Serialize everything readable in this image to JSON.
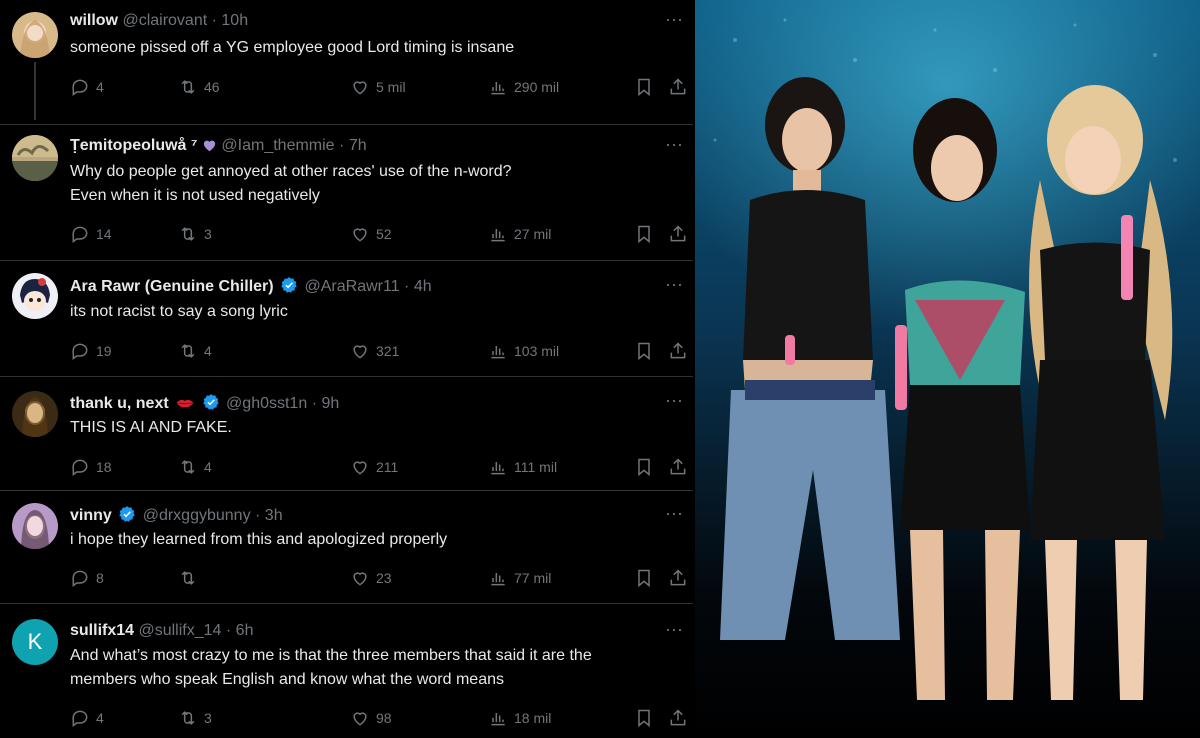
{
  "tweets": [
    {
      "name": "willow",
      "handle": "@clairovant",
      "time": "10h",
      "text": "someone pissed off a YG employee good Lord timing is insane",
      "replies": "4",
      "reposts": "46",
      "likes": "5 mil",
      "views": "290 mil"
    },
    {
      "name": "Ṭemitopeoluwå ⁷",
      "handle": "@Iam_themmie",
      "time": "7h",
      "text": "Why do people get annoyed at other races' use of the n-word?",
      "text2": "Even when it is not used negatively",
      "replies": "14",
      "reposts": "3",
      "likes": "52",
      "views": "27 mil"
    },
    {
      "name": "Ara Rawr (Genuine Chiller)",
      "handle": "@AraRawr11",
      "time": "4h",
      "text": "its not racist to say a song lyric",
      "replies": "19",
      "reposts": "4",
      "likes": "321",
      "views": "103 mil"
    },
    {
      "name": "thank u, next",
      "handle": "@gh0sst1n",
      "time": "9h",
      "text": "THIS IS AI AND FAKE.",
      "replies": "18",
      "reposts": "4",
      "likes": "211",
      "views": "111 mil"
    },
    {
      "name": "vinny",
      "handle": "@drxggybunny",
      "time": "3h",
      "text": "i hope they learned from this and apologized properly",
      "replies": "8",
      "reposts": "",
      "likes": "23",
      "views": "77 mil"
    },
    {
      "name": "sullifx14",
      "handle": "@sullifx_14",
      "time": "6h",
      "avatar_letter": "K",
      "text": "And what’s most crazy to me is that the three members that said it are the",
      "text2": "members who speak English and know what the word means",
      "replies": "4",
      "reposts": "3",
      "likes": "98",
      "views": "18 mil"
    }
  ],
  "separator": "·",
  "more_glyph": "···",
  "colors": {
    "background": "#000000",
    "text": "#e7e9ea",
    "muted": "#71767b",
    "border": "#2f3336",
    "verified": "#1d9bf0",
    "avatar_k": "#0fa3b1"
  },
  "icons": [
    "reply-icon",
    "repost-icon",
    "like-icon",
    "views-icon",
    "bookmark-icon",
    "share-icon",
    "verified-icon",
    "purple-heart-icon",
    "lips-icon",
    "more-icon"
  ]
}
